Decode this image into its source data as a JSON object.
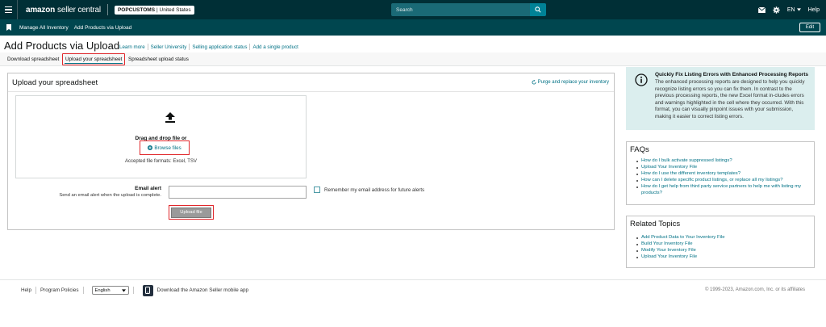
{
  "topbar": {
    "logo_brand": "amazon",
    "logo_suffix": "seller central",
    "store_name": "POPCUSTOMS",
    "store_country": "| United States",
    "search_placeholder": "Search",
    "lang": "EN",
    "help": "Help"
  },
  "bookmarks": {
    "items": [
      "Manage All Inventory",
      "Add Products via Upload"
    ],
    "edit": "Edit"
  },
  "page": {
    "title": "Add Products via Upload",
    "links": [
      "Learn more",
      "Seller University",
      "Selling application status",
      "Add a single product"
    ]
  },
  "tabs": [
    "Download spreadsheet",
    "Upload your spreadsheet",
    "Spreadsheet upload status"
  ],
  "upload": {
    "title": "Upload your spreadsheet",
    "purge_link": "Purge and replace your inventory",
    "drag_text": "Drag and drop file or",
    "browse": "Browse files",
    "formats": "Accepted file formats: Excel, TSV",
    "email_label": "Email alert",
    "email_hint": "Send an email alert when the upload is complete.",
    "email_value": "",
    "remember": "Remember my email address for future alerts",
    "upload_button": "Upload file"
  },
  "info": {
    "title": "Quickly Fix Listing Errors with Enhanced Processing Reports",
    "body": "The enhanced processing reports are designed to help you quickly recognize listing errors so you can fix them. In contrast to the previous processing reports, the new Excel format in-cludes errors and warnings highlighted in the cell where they occurred. With this format, you can visually pinpoint issues with your submission, making it easier to correct listing errors."
  },
  "faqs": {
    "title": "FAQs",
    "items": [
      "How do I bulk activate suppressed listings?",
      "Upload Your Inventory File",
      "How do I use the different inventory templates?",
      "How can I delete specific product listings, or replace all my listings?",
      "How do I get help from third party service partners to help me with listing my products?"
    ]
  },
  "related": {
    "title": "Related Topics",
    "items": [
      "Add Product Data to Your Inventory File",
      "Build Your Inventory File",
      "Modify Your Inventory File",
      "Upload Your Inventory File"
    ]
  },
  "footer": {
    "help": "Help",
    "policies": "Program Policies",
    "language": "English",
    "mobile": "Download the Amazon Seller mobile app",
    "copyright": "© 1999-2023, Amazon.com, Inc. or its affiliates"
  },
  "colors": {
    "topbar": "#002f36",
    "bookbar": "#00464f",
    "link": "#007185",
    "highlight": "#e0282c",
    "info_bg": "#dbeeee"
  }
}
